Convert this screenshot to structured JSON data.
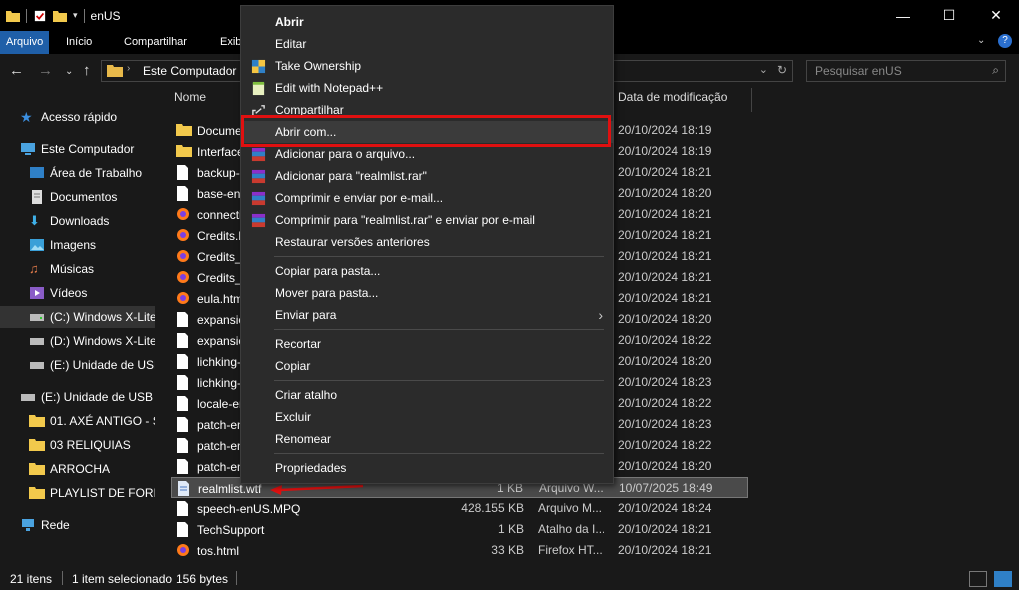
{
  "window": {
    "title": "enUS",
    "controls": {
      "minimize": "—",
      "maximize": "☐",
      "close": "✕"
    }
  },
  "ribbon": {
    "tabs": [
      "Arquivo",
      "Início",
      "Compartilhar",
      "Exib"
    ],
    "active_tab": "Arquivo"
  },
  "address": {
    "path_segment": "Este Computador",
    "search_placeholder": "Pesquisar enUS"
  },
  "sidebar": {
    "items": [
      {
        "label": "Acesso rápido",
        "icon": "star-icon"
      },
      {
        "label": "Este Computador",
        "icon": "computer-icon"
      },
      {
        "label": "Área de Trabalho",
        "icon": "desktop-icon"
      },
      {
        "label": "Documentos",
        "icon": "documents-icon"
      },
      {
        "label": "Downloads",
        "icon": "download-icon"
      },
      {
        "label": "Imagens",
        "icon": "pictures-icon"
      },
      {
        "label": "Músicas",
        "icon": "music-icon"
      },
      {
        "label": "Vídeos",
        "icon": "videos-icon"
      },
      {
        "label": "(C:) Windows X-Lite",
        "icon": "drive-icon"
      },
      {
        "label": "(D:) Windows X-Lite",
        "icon": "drive-icon"
      },
      {
        "label": "(E:) Unidade de USB",
        "icon": "usb-drive-icon"
      },
      {
        "label": "(E:) Unidade de USB",
        "icon": "usb-drive-icon"
      },
      {
        "label": "01. AXÉ ANTIGO - S",
        "icon": "folder-icon"
      },
      {
        "label": "03 RELIQUIAS",
        "icon": "folder-icon"
      },
      {
        "label": "ARROCHA",
        "icon": "folder-icon"
      },
      {
        "label": "PLAYLIST DE FORRO",
        "icon": "folder-icon"
      },
      {
        "label": "Rede",
        "icon": "network-icon"
      }
    ]
  },
  "file_list": {
    "headers": {
      "name": "Nome",
      "date": "Data de modificação"
    },
    "rows": [
      {
        "name": "Docume",
        "size": "",
        "type": "",
        "date": "20/10/2024 18:19",
        "icon": "folder-icon"
      },
      {
        "name": "Interface",
        "size": "",
        "type": "",
        "date": "20/10/2024 18:19",
        "icon": "folder-icon"
      },
      {
        "name": "backup-",
        "size": "",
        "type": "",
        "date": "20/10/2024 18:21",
        "icon": "file-icon"
      },
      {
        "name": "base-enU",
        "size": "",
        "type": "",
        "date": "20/10/2024 18:20",
        "icon": "file-icon"
      },
      {
        "name": "connecti",
        "size": "",
        "type": "",
        "date": "20/10/2024 18:21",
        "icon": "firefox-icon"
      },
      {
        "name": "Credits.h",
        "size": "",
        "type": "",
        "date": "20/10/2024 18:21",
        "icon": "firefox-icon"
      },
      {
        "name": "Credits_B",
        "size": "",
        "type": "",
        "date": "20/10/2024 18:21",
        "icon": "firefox-icon"
      },
      {
        "name": "Credits_L",
        "size": "",
        "type": "",
        "date": "20/10/2024 18:21",
        "icon": "firefox-icon"
      },
      {
        "name": "eula.html",
        "size": "",
        "type": "",
        "date": "20/10/2024 18:21",
        "icon": "firefox-icon"
      },
      {
        "name": "expansio",
        "size": "",
        "type": "",
        "date": "20/10/2024 18:20",
        "icon": "file-icon"
      },
      {
        "name": "expansio",
        "size": "",
        "type": "",
        "date": "20/10/2024 18:22",
        "icon": "file-icon"
      },
      {
        "name": "lichking-",
        "size": "",
        "type": "",
        "date": "20/10/2024 18:20",
        "icon": "file-icon"
      },
      {
        "name": "lichking-",
        "size": "",
        "type": "",
        "date": "20/10/2024 18:23",
        "icon": "file-icon"
      },
      {
        "name": "locale-en",
        "size": "",
        "type": "",
        "date": "20/10/2024 18:22",
        "icon": "file-icon"
      },
      {
        "name": "patch-en",
        "size": "",
        "type": "",
        "date": "20/10/2024 18:23",
        "icon": "file-icon"
      },
      {
        "name": "patch-en",
        "size": "",
        "type": "",
        "date": "20/10/2024 18:22",
        "icon": "file-icon"
      },
      {
        "name": "patch-en",
        "size": "",
        "type": "",
        "date": "20/10/2024 18:20",
        "icon": "file-icon"
      },
      {
        "name": "realmlist.wtf",
        "size": "1 KB",
        "type": "Arquivo W...",
        "date": "10/07/2025 18:49",
        "icon": "text-file-icon",
        "selected": true
      },
      {
        "name": "speech-enUS.MPQ",
        "size": "428.155 KB",
        "type": "Arquivo M...",
        "date": "20/10/2024 18:24",
        "icon": "file-icon"
      },
      {
        "name": "TechSupport",
        "size": "1 KB",
        "type": "Atalho da I...",
        "date": "20/10/2024 18:21",
        "icon": "file-icon"
      },
      {
        "name": "tos.html",
        "size": "33 KB",
        "type": "Firefox HT...",
        "date": "20/10/2024 18:21",
        "icon": "firefox-icon"
      }
    ]
  },
  "context_menu": {
    "items": [
      {
        "label": "Abrir",
        "bold": true,
        "icon": ""
      },
      {
        "label": "Editar",
        "icon": ""
      },
      {
        "label": "Take Ownership",
        "icon": "shield-icon"
      },
      {
        "label": "Edit with Notepad++",
        "icon": "notepad-plus-icon"
      },
      {
        "label": "Compartilhar",
        "icon": "share-icon"
      },
      {
        "label": "Abrir com...",
        "icon": "",
        "highlighted": true
      },
      {
        "label": "Adicionar para o arquivo...",
        "icon": "winrar-icon"
      },
      {
        "label": "Adicionar para \"realmlist.rar\"",
        "icon": "winrar-icon"
      },
      {
        "label": "Comprimir e enviar por e-mail...",
        "icon": "winrar-icon"
      },
      {
        "label": "Comprimir para \"realmlist.rar\" e enviar por e-mail",
        "icon": "winrar-icon"
      },
      {
        "label": "Restaurar versões anteriores",
        "icon": ""
      },
      {
        "label": "Copiar para pasta...",
        "icon": ""
      },
      {
        "label": "Mover para pasta...",
        "icon": ""
      },
      {
        "label": "Enviar para",
        "icon": "",
        "submenu": true
      },
      {
        "label": "Recortar",
        "icon": ""
      },
      {
        "label": "Copiar",
        "icon": ""
      },
      {
        "label": "Criar atalho",
        "icon": ""
      },
      {
        "label": "Excluir",
        "icon": ""
      },
      {
        "label": "Renomear",
        "icon": ""
      },
      {
        "label": "Propriedades",
        "icon": ""
      }
    ]
  },
  "status": {
    "count": "21 itens",
    "selection": "1 item selecionado",
    "selection_size": "156 bytes"
  },
  "colors": {
    "accent": "#1f5fa8",
    "highlight_box": "#e01010",
    "annotation_arrow": "#e01010"
  }
}
